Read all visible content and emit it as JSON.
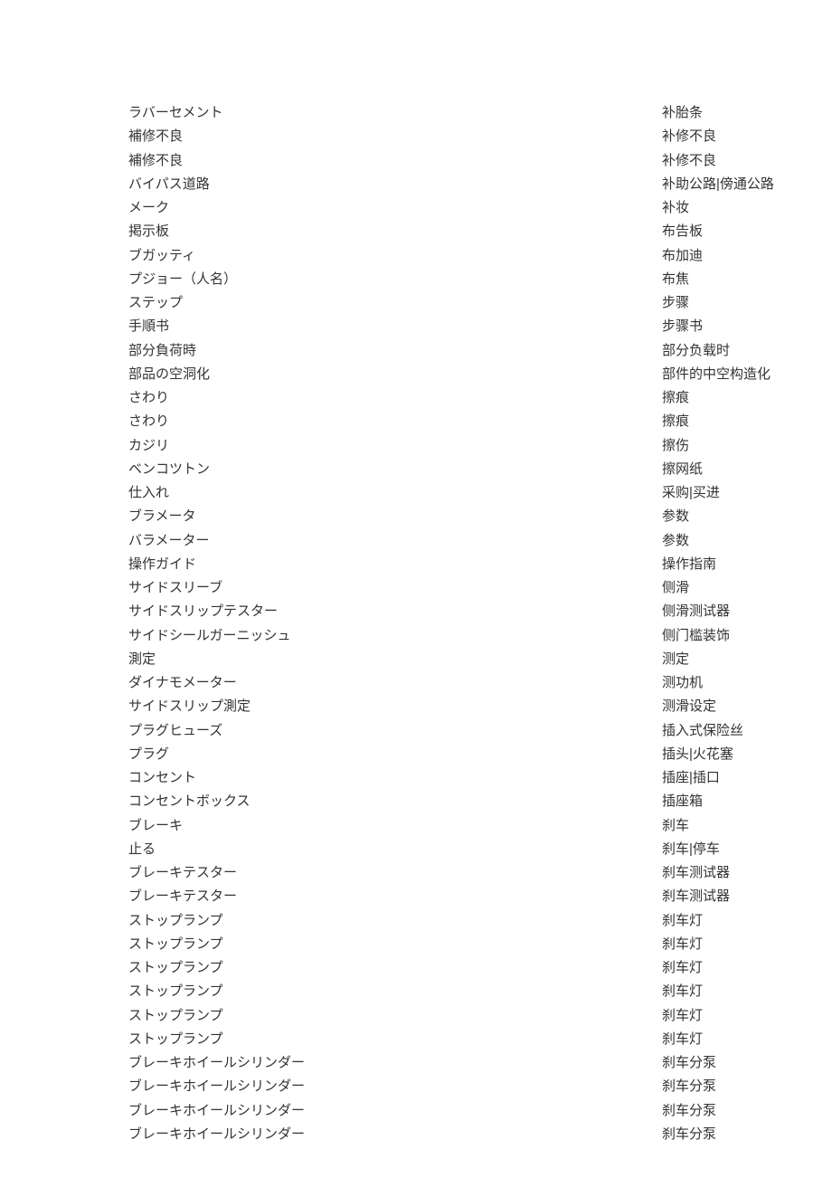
{
  "entries": [
    {
      "jp": "ラバーセメント",
      "cn": "补胎条"
    },
    {
      "jp": "補修不良",
      "cn": "补修不良"
    },
    {
      "jp": "補修不良",
      "cn": "补修不良"
    },
    {
      "jp": "バイパス道路",
      "cn": "补助公路|傍通公路"
    },
    {
      "jp": "メーク",
      "cn": "补妆"
    },
    {
      "jp": "掲示板",
      "cn": "布告板"
    },
    {
      "jp": "ブガッティ",
      "cn": "布加迪"
    },
    {
      "jp": "プジョー（人名）",
      "cn": "布焦"
    },
    {
      "jp": "ステップ",
      "cn": "步骤"
    },
    {
      "jp": "手順书",
      "cn": "步骤书"
    },
    {
      "jp": "部分負荷時",
      "cn": "部分负载时"
    },
    {
      "jp": "部品の空洞化",
      "cn": "部件的中空构造化"
    },
    {
      "jp": "さわり",
      "cn": "擦痕"
    },
    {
      "jp": "さわり",
      "cn": "擦痕"
    },
    {
      "jp": "カジリ",
      "cn": "擦伤"
    },
    {
      "jp": "ベンコツトン",
      "cn": "擦网纸"
    },
    {
      "jp": "仕入れ",
      "cn": "采购|买进"
    },
    {
      "jp": "ブラメータ",
      "cn": "参数"
    },
    {
      "jp": "バラメーター",
      "cn": "参数"
    },
    {
      "jp": "操作ガイド",
      "cn": "操作指南"
    },
    {
      "jp": "サイドスリーブ",
      "cn": "侧滑"
    },
    {
      "jp": "サイドスリップテスター",
      "cn": "侧滑测试器"
    },
    {
      "jp": "サイドシールガーニッシュ",
      "cn": "侧门槛装饰"
    },
    {
      "jp": "測定",
      "cn": "测定"
    },
    {
      "jp": "ダイナモメーター",
      "cn": "测功机"
    },
    {
      "jp": "サイドスリップ測定",
      "cn": "测滑设定"
    },
    {
      "jp": "プラグヒューズ",
      "cn": "插入式保险丝"
    },
    {
      "jp": "プラグ",
      "cn": "插头|火花塞"
    },
    {
      "jp": "コンセント",
      "cn": "插座|插口"
    },
    {
      "jp": "コンセントボックス",
      "cn": "插座箱"
    },
    {
      "jp": "ブレーキ",
      "cn": "刹车"
    },
    {
      "jp": "止る",
      "cn": "刹车|停车"
    },
    {
      "jp": "ブレーキテスター",
      "cn": "刹车测试器"
    },
    {
      "jp": "ブレーキテスター",
      "cn": "刹车测试器"
    },
    {
      "jp": "ストップランプ",
      "cn": "刹车灯"
    },
    {
      "jp": "ストップランプ",
      "cn": "刹车灯"
    },
    {
      "jp": "ストップランプ",
      "cn": "刹车灯"
    },
    {
      "jp": "ストップランプ",
      "cn": "刹车灯"
    },
    {
      "jp": "ストップランプ",
      "cn": "刹车灯"
    },
    {
      "jp": "ストップランプ",
      "cn": "刹车灯"
    },
    {
      "jp": "ブレーキホイールシリンダー",
      "cn": "刹车分泵"
    },
    {
      "jp": "ブレーキホイールシリンダー",
      "cn": "刹车分泵"
    },
    {
      "jp": "ブレーキホイールシリンダー",
      "cn": "刹车分泵"
    },
    {
      "jp": "ブレーキホイールシリンダー",
      "cn": "刹车分泵"
    }
  ]
}
